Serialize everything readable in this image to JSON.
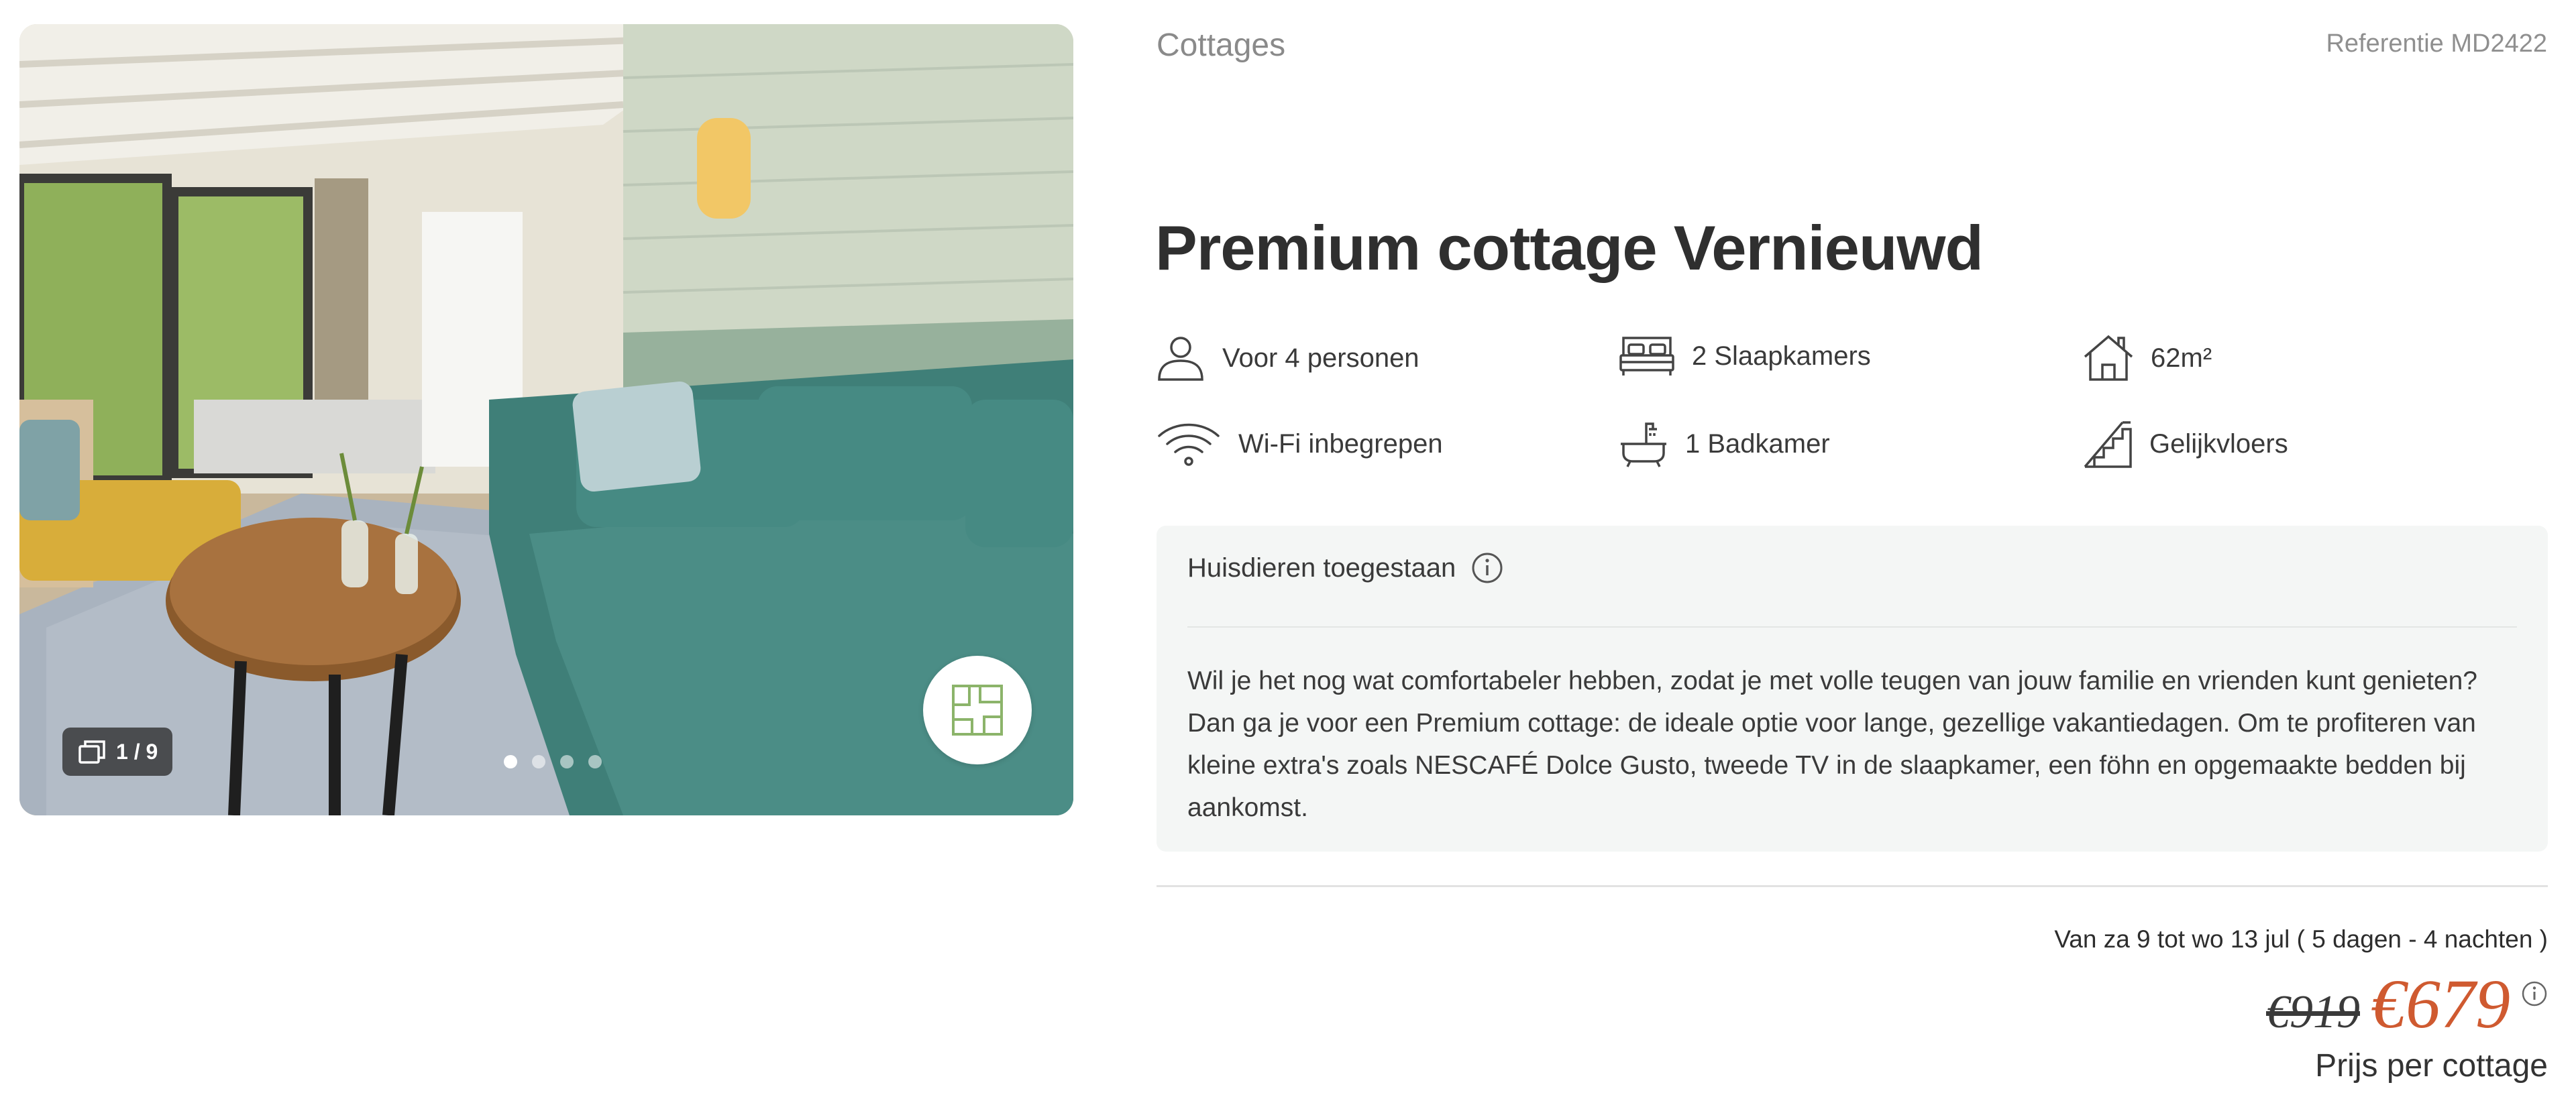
{
  "gallery": {
    "counter": "1 / 9",
    "dot_count": 4,
    "active_dot": 0
  },
  "header": {
    "category": "Cottages",
    "reference": "Referentie MD2422"
  },
  "title": "Premium cottage Vernieuwd",
  "features": [
    {
      "icon": "person-icon",
      "label": "Voor 4 personen"
    },
    {
      "icon": "bed-icon",
      "label": "2 Slaapkamers"
    },
    {
      "icon": "house-icon",
      "label": "62m²"
    },
    {
      "icon": "wifi-icon",
      "label": "Wi-Fi inbegrepen"
    },
    {
      "icon": "bathtub-icon",
      "label": "1 Badkamer"
    },
    {
      "icon": "stairs-icon",
      "label": "Gelijkvloers"
    }
  ],
  "info": {
    "pets": "Huisdieren toegestaan",
    "description": "Wil je het nog wat comfortabeler hebben, zodat je met volle teugen van jouw familie en vrienden kunt genieten? Dan ga je voor een Premium cottage: de ideale optie voor lange, gezellige vakantiedagen. Om te profiteren van kleine extra's zoals NESCAFÉ Dolce Gusto, tweede TV in de slaapkamer, een föhn en opgemaakte bedden bij aankomst."
  },
  "booking": {
    "dates": "Van za 9 tot wo 13 jul ( 5 dagen - 4 nachten )",
    "old_price": "€919",
    "new_price": "€679",
    "price_note": "Prijs per cottage"
  },
  "colors": {
    "accent_price": "#cf5a30",
    "floorplan_green": "#8cb46a",
    "panel_bg": "#f4f6f5"
  }
}
